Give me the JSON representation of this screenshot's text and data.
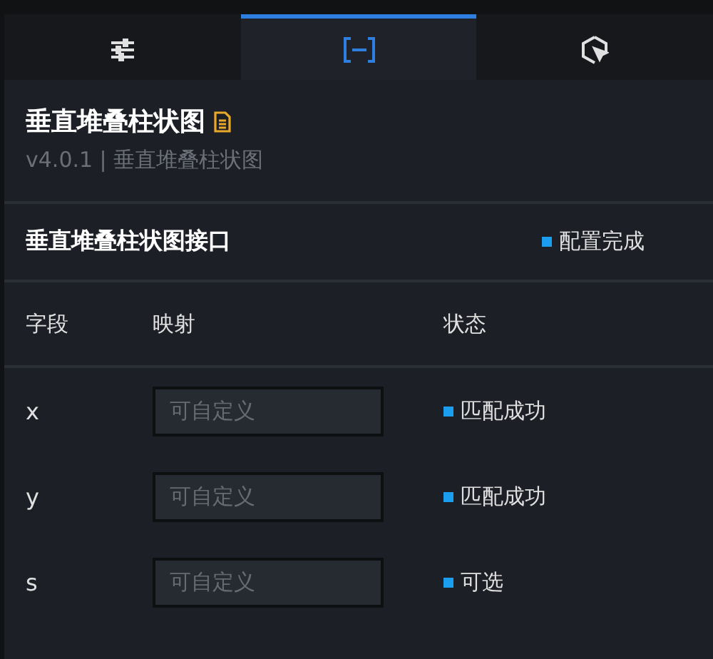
{
  "tabs": [
    {
      "kind": "sliders",
      "selected": false
    },
    {
      "kind": "brackets",
      "selected": true
    },
    {
      "kind": "pointer",
      "selected": false
    }
  ],
  "header": {
    "title": "垂直堆叠柱状图",
    "subtitle": "v4.0.1 | 垂直堆叠柱状图"
  },
  "interface": {
    "title": "垂直堆叠柱状图接口",
    "status": "配置完成"
  },
  "table": {
    "columns": [
      "字段",
      "映射",
      "状态"
    ],
    "rows": [
      {
        "field": "x",
        "placeholder": "可自定义",
        "status": "匹配成功"
      },
      {
        "field": "y",
        "placeholder": "可自定义",
        "status": "匹配成功"
      },
      {
        "field": "s",
        "placeholder": "可自定义",
        "status": "可选"
      }
    ]
  }
}
